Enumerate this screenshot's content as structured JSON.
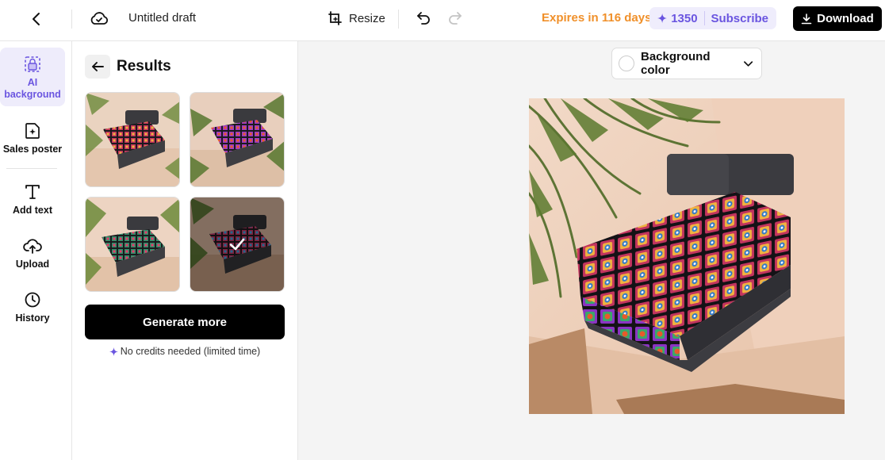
{
  "header": {
    "doc_title": "Untitled draft",
    "resize_label": "Resize",
    "expires_label": "Expires in 116 days",
    "credits_count": "1350",
    "subscribe_label": "Subscribe",
    "download_label": "Download"
  },
  "sidebar": {
    "items": [
      {
        "label": "AI background",
        "icon": "ai-background-icon",
        "active": true
      },
      {
        "label": "Sales poster",
        "icon": "sales-poster-icon",
        "active": false
      },
      {
        "label": "Add text",
        "icon": "text-icon",
        "active": false
      },
      {
        "label": "Upload",
        "icon": "upload-cloud-icon",
        "active": false
      },
      {
        "label": "History",
        "icon": "clock-icon",
        "active": false
      }
    ]
  },
  "panel": {
    "title": "Results",
    "generate_label": "Generate more",
    "note": "No credits needed (limited time)",
    "selected_result": 4
  },
  "canvas": {
    "background_dropdown_label": "Background color"
  },
  "colors": {
    "accent": "#6a55e0",
    "accent_bg": "#efedfc",
    "expires": "#f0902a",
    "primary_button": "#000000"
  }
}
